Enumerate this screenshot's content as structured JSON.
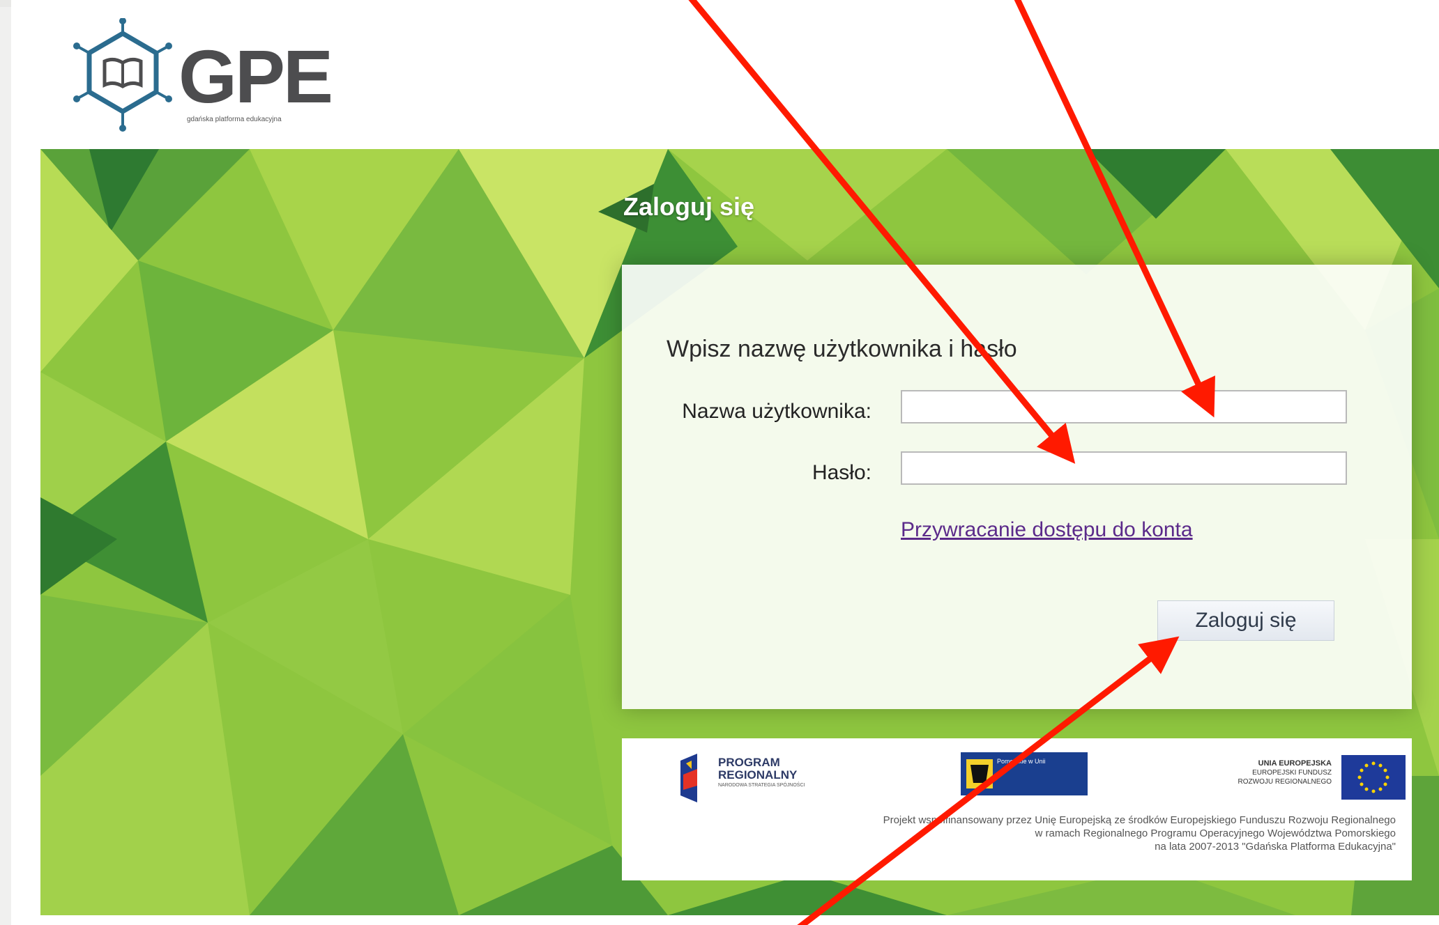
{
  "logo": {
    "word": "GPE",
    "tagline": "gdańska platforma edukacyjna"
  },
  "login": {
    "header": "Zaloguj się",
    "prompt": "Wpisz nazwę użytkownika i hasło",
    "username_label": "Nazwa użytkownika:",
    "username_value": "",
    "password_label": "Hasło:",
    "password_value": "",
    "recover_link": "Przywracanie dostępu do konta",
    "submit_label": "Zaloguj się"
  },
  "footer": {
    "program_title": "PROGRAM REGIONALNY",
    "program_sub": "NARODOWA STRATEGIA SPÓJNOŚCI",
    "pomorskie_text": "Pomorskie w Unii",
    "ue_title": "UNIA EUROPEJSKA",
    "ue_sub1": "EUROPEJSKI FUNDUSZ",
    "ue_sub2": "ROZWOJU REGIONALNEGO",
    "project_line1": "Projekt współfinansowany przez Unię Europejską ze środków Europejskiego Funduszu Rozwoju Regionalnego",
    "project_line2": "w ramach Regionalnego Programu Operacyjnego Województwa Pomorskiego",
    "project_line3": "na lata 2007-2013 \"Gdańska Platforma Edukacyjna\""
  },
  "colors": {
    "accent_green": "#8cc63f",
    "annotation_arrow": "#ff1a00",
    "link": "#5b2a8a"
  },
  "icons": [
    "gpe-logo-icon",
    "program-regionalny-logo",
    "pomorskie-logo",
    "eu-flag-icon"
  ]
}
